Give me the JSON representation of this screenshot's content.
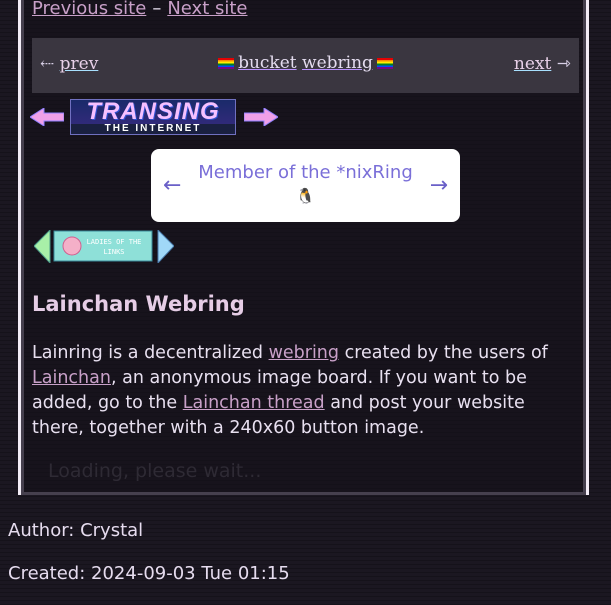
{
  "site_nav": {
    "previous": "Previous site",
    "separator": "–",
    "next": "Next site"
  },
  "bucket": {
    "prev_arrow": "⇠",
    "prev": "prev",
    "title_a": "bucket",
    "title_b": "webring",
    "next": "next",
    "next_arrow": "⇾"
  },
  "transing": {
    "big": "TRANSING",
    "small": "THE INTERNET"
  },
  "nixring": {
    "left": "←",
    "right": "→",
    "text": "Member of the *nixRing",
    "tux": "🐧"
  },
  "lol": {
    "line1": "LADIES OF THE",
    "line2": "LINKS"
  },
  "lainchan": {
    "heading": "Lainchan Webring",
    "p1": "Lainring is a decentralized ",
    "link1": "webring",
    "p2": " created by the users of ",
    "link2": "Lainchan",
    "p3": ", an anonymous image board. If you want to be added, go to the ",
    "link3": "Lainchan thread",
    "p4": " and post your website there, together with a 240x60 button image.",
    "loading": "Loading, please wait..."
  },
  "meta": {
    "author": "Author: Crystal",
    "created": "Created: 2024-09-03 Tue 01:15"
  },
  "colors": {
    "background": "#1b1721",
    "link": "#c8a0c8",
    "nix_text": "#7a6fd8"
  }
}
